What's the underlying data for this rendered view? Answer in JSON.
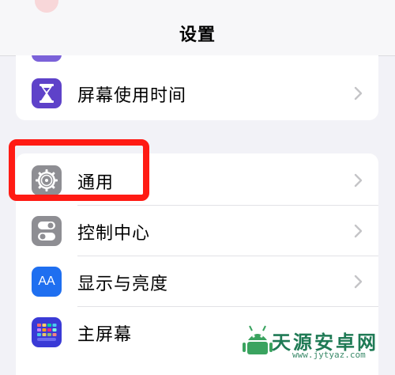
{
  "nav": {
    "title": "设置"
  },
  "rows": {
    "screen_time": {
      "label": "屏幕使用时间",
      "icon": "hourglass-icon",
      "color": "#5e42c9"
    },
    "general": {
      "label": "通用",
      "icon": "gear-icon",
      "color": "#8e8e93"
    },
    "control_center": {
      "label": "控制中心",
      "icon": "toggle-icon",
      "color": "#8e8e93"
    },
    "display": {
      "label": "显示与亮度",
      "icon": "text-size-icon",
      "icon_text": "AA",
      "color": "#1f6ff0"
    },
    "home_screen": {
      "label": "主屏幕",
      "icon": "app-grid-icon",
      "color": "#3a3ad6"
    }
  },
  "annotation": {
    "highlight_color": "#ff1b14"
  },
  "watermark": {
    "text": "天源安卓网",
    "url": "www.jytyaz.com",
    "color": "#1f7a55"
  }
}
